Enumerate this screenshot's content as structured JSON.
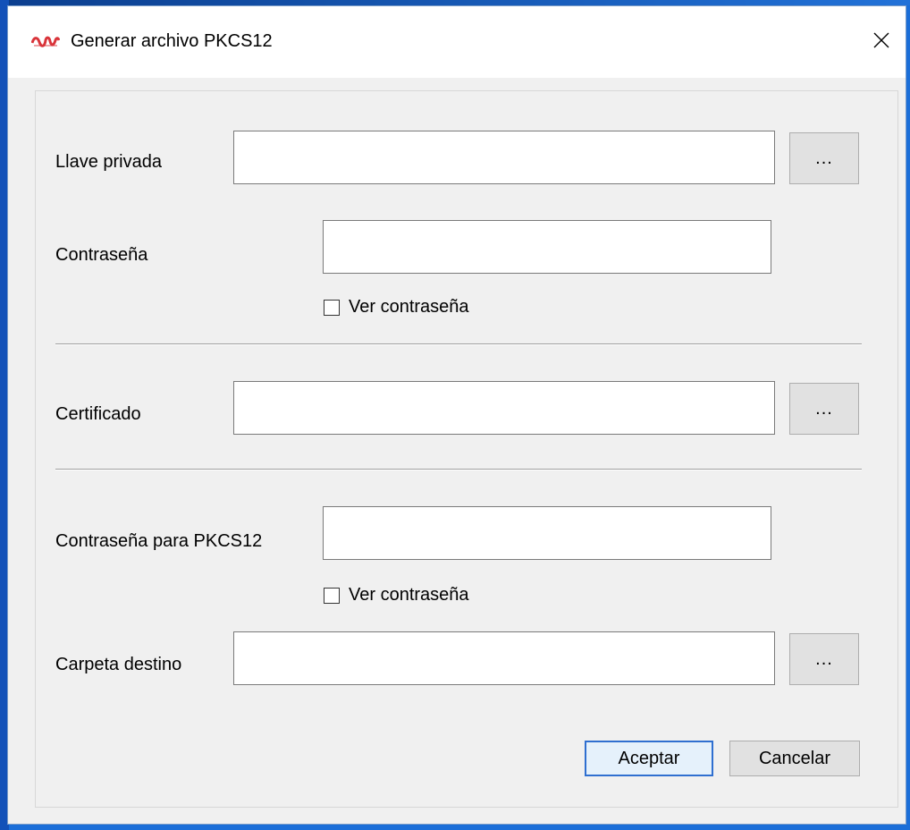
{
  "window": {
    "title": "Generar archivo PKCS12",
    "icon": "app-logo-icon",
    "close_icon": "close-icon"
  },
  "form": {
    "private_key": {
      "label": "Llave privada",
      "value": "",
      "browse_label": "..."
    },
    "password": {
      "label": "Contraseña",
      "value": "",
      "show_label": "Ver contraseña",
      "show_checked": false
    },
    "certificate": {
      "label": "Certificado",
      "value": "",
      "browse_label": "..."
    },
    "pkcs12_password": {
      "label": "Contraseña para PKCS12",
      "value": "",
      "show_label": "Ver contraseña",
      "show_checked": false
    },
    "destination": {
      "label": "Carpeta destino",
      "value": "",
      "browse_label": "..."
    }
  },
  "buttons": {
    "accept": "Aceptar",
    "cancel": "Cancelar"
  },
  "colors": {
    "default_button_border": "#2f6fd0",
    "app_icon": "#d9343a"
  }
}
